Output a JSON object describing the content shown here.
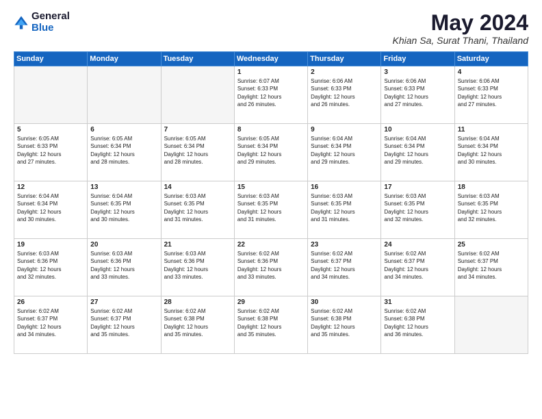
{
  "logo": {
    "general": "General",
    "blue": "Blue"
  },
  "title": "May 2024",
  "subtitle": "Khian Sa, Surat Thani, Thailand",
  "days_header": [
    "Sunday",
    "Monday",
    "Tuesday",
    "Wednesday",
    "Thursday",
    "Friday",
    "Saturday"
  ],
  "weeks": [
    [
      {
        "day": "",
        "info": "",
        "empty": true
      },
      {
        "day": "",
        "info": "",
        "empty": true
      },
      {
        "day": "",
        "info": "",
        "empty": true
      },
      {
        "day": "1",
        "info": "Sunrise: 6:07 AM\nSunset: 6:33 PM\nDaylight: 12 hours\nand 26 minutes.",
        "empty": false
      },
      {
        "day": "2",
        "info": "Sunrise: 6:06 AM\nSunset: 6:33 PM\nDaylight: 12 hours\nand 26 minutes.",
        "empty": false
      },
      {
        "day": "3",
        "info": "Sunrise: 6:06 AM\nSunset: 6:33 PM\nDaylight: 12 hours\nand 27 minutes.",
        "empty": false
      },
      {
        "day": "4",
        "info": "Sunrise: 6:06 AM\nSunset: 6:33 PM\nDaylight: 12 hours\nand 27 minutes.",
        "empty": false
      }
    ],
    [
      {
        "day": "5",
        "info": "Sunrise: 6:05 AM\nSunset: 6:33 PM\nDaylight: 12 hours\nand 27 minutes.",
        "empty": false
      },
      {
        "day": "6",
        "info": "Sunrise: 6:05 AM\nSunset: 6:34 PM\nDaylight: 12 hours\nand 28 minutes.",
        "empty": false
      },
      {
        "day": "7",
        "info": "Sunrise: 6:05 AM\nSunset: 6:34 PM\nDaylight: 12 hours\nand 28 minutes.",
        "empty": false
      },
      {
        "day": "8",
        "info": "Sunrise: 6:05 AM\nSunset: 6:34 PM\nDaylight: 12 hours\nand 29 minutes.",
        "empty": false
      },
      {
        "day": "9",
        "info": "Sunrise: 6:04 AM\nSunset: 6:34 PM\nDaylight: 12 hours\nand 29 minutes.",
        "empty": false
      },
      {
        "day": "10",
        "info": "Sunrise: 6:04 AM\nSunset: 6:34 PM\nDaylight: 12 hours\nand 29 minutes.",
        "empty": false
      },
      {
        "day": "11",
        "info": "Sunrise: 6:04 AM\nSunset: 6:34 PM\nDaylight: 12 hours\nand 30 minutes.",
        "empty": false
      }
    ],
    [
      {
        "day": "12",
        "info": "Sunrise: 6:04 AM\nSunset: 6:34 PM\nDaylight: 12 hours\nand 30 minutes.",
        "empty": false
      },
      {
        "day": "13",
        "info": "Sunrise: 6:04 AM\nSunset: 6:35 PM\nDaylight: 12 hours\nand 30 minutes.",
        "empty": false
      },
      {
        "day": "14",
        "info": "Sunrise: 6:03 AM\nSunset: 6:35 PM\nDaylight: 12 hours\nand 31 minutes.",
        "empty": false
      },
      {
        "day": "15",
        "info": "Sunrise: 6:03 AM\nSunset: 6:35 PM\nDaylight: 12 hours\nand 31 minutes.",
        "empty": false
      },
      {
        "day": "16",
        "info": "Sunrise: 6:03 AM\nSunset: 6:35 PM\nDaylight: 12 hours\nand 31 minutes.",
        "empty": false
      },
      {
        "day": "17",
        "info": "Sunrise: 6:03 AM\nSunset: 6:35 PM\nDaylight: 12 hours\nand 32 minutes.",
        "empty": false
      },
      {
        "day": "18",
        "info": "Sunrise: 6:03 AM\nSunset: 6:35 PM\nDaylight: 12 hours\nand 32 minutes.",
        "empty": false
      }
    ],
    [
      {
        "day": "19",
        "info": "Sunrise: 6:03 AM\nSunset: 6:36 PM\nDaylight: 12 hours\nand 32 minutes.",
        "empty": false
      },
      {
        "day": "20",
        "info": "Sunrise: 6:03 AM\nSunset: 6:36 PM\nDaylight: 12 hours\nand 33 minutes.",
        "empty": false
      },
      {
        "day": "21",
        "info": "Sunrise: 6:03 AM\nSunset: 6:36 PM\nDaylight: 12 hours\nand 33 minutes.",
        "empty": false
      },
      {
        "day": "22",
        "info": "Sunrise: 6:02 AM\nSunset: 6:36 PM\nDaylight: 12 hours\nand 33 minutes.",
        "empty": false
      },
      {
        "day": "23",
        "info": "Sunrise: 6:02 AM\nSunset: 6:37 PM\nDaylight: 12 hours\nand 34 minutes.",
        "empty": false
      },
      {
        "day": "24",
        "info": "Sunrise: 6:02 AM\nSunset: 6:37 PM\nDaylight: 12 hours\nand 34 minutes.",
        "empty": false
      },
      {
        "day": "25",
        "info": "Sunrise: 6:02 AM\nSunset: 6:37 PM\nDaylight: 12 hours\nand 34 minutes.",
        "empty": false
      }
    ],
    [
      {
        "day": "26",
        "info": "Sunrise: 6:02 AM\nSunset: 6:37 PM\nDaylight: 12 hours\nand 34 minutes.",
        "empty": false
      },
      {
        "day": "27",
        "info": "Sunrise: 6:02 AM\nSunset: 6:37 PM\nDaylight: 12 hours\nand 35 minutes.",
        "empty": false
      },
      {
        "day": "28",
        "info": "Sunrise: 6:02 AM\nSunset: 6:38 PM\nDaylight: 12 hours\nand 35 minutes.",
        "empty": false
      },
      {
        "day": "29",
        "info": "Sunrise: 6:02 AM\nSunset: 6:38 PM\nDaylight: 12 hours\nand 35 minutes.",
        "empty": false
      },
      {
        "day": "30",
        "info": "Sunrise: 6:02 AM\nSunset: 6:38 PM\nDaylight: 12 hours\nand 35 minutes.",
        "empty": false
      },
      {
        "day": "31",
        "info": "Sunrise: 6:02 AM\nSunset: 6:38 PM\nDaylight: 12 hours\nand 36 minutes.",
        "empty": false
      },
      {
        "day": "",
        "info": "",
        "empty": true
      }
    ]
  ]
}
